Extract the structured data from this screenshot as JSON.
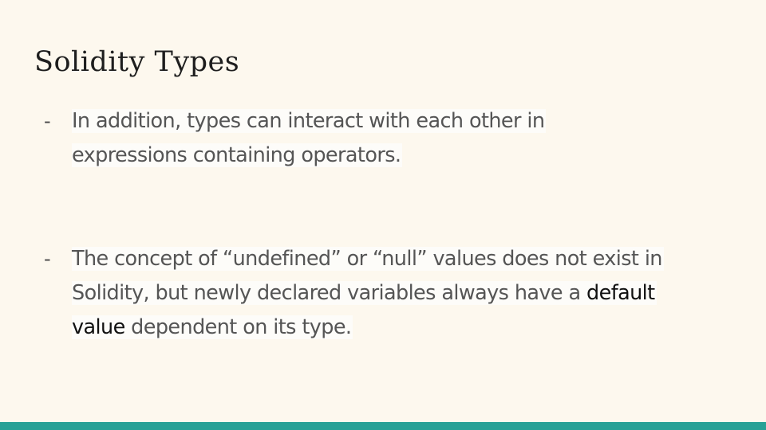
{
  "slide": {
    "title": "Solidity Types",
    "bullets": [
      {
        "marker": "-",
        "lines": [
          "In addition, types can interact with each other in",
          "expressions containing operators."
        ]
      },
      {
        "marker": "-",
        "line1": "The concept of “undefined” or “null” values does not exist in",
        "line2_pre": "Solidity, but newly declared variables always have a ",
        "line2_emph": "default",
        "line3_emph": "value",
        "line3_post": " dependent on its type."
      }
    ],
    "colors": {
      "background": "#fdf8ee",
      "accent_bar": "#27a196",
      "body_text": "#555555",
      "emphasis_text": "#111111"
    }
  }
}
